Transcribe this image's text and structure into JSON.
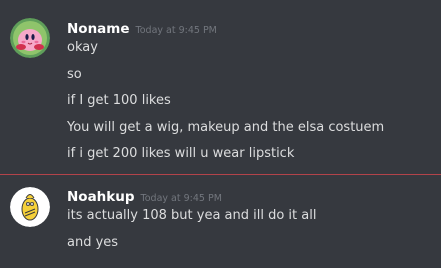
{
  "messages": [
    {
      "username": "Noname",
      "timestamp": "Today at 9:45 PM",
      "avatar_icon": "kirby-avatar",
      "lines": [
        "okay",
        "so",
        "if I get 100 likes",
        "You will get a wig, makeup and the elsa costuem",
        "if i get 200 likes will u wear lipstick"
      ]
    },
    {
      "username": "Noahkup",
      "timestamp": "Today at 9:45 PM",
      "avatar_icon": "cartoon-character-avatar",
      "lines": [
        "its actually 108 but yea and ill do it all",
        "and yes"
      ]
    }
  ],
  "colors": {
    "background": "#36393f",
    "username": "#ffffff",
    "message_text": "#dcddde",
    "timestamp": "#72767d",
    "new_message_divider": "#b3434a"
  }
}
